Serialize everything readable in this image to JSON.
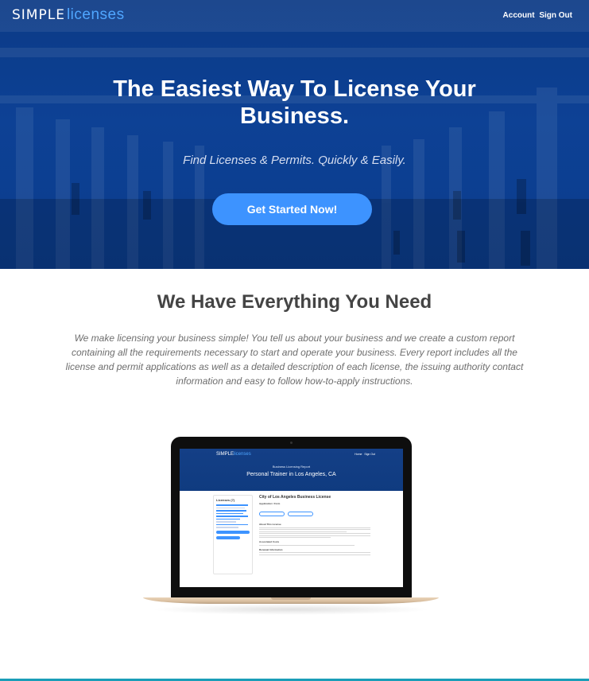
{
  "brand": {
    "part1": "SIMPLE",
    "part2": "licenses"
  },
  "nav": {
    "account": "Account",
    "signout": "Sign Out"
  },
  "hero": {
    "title": "The Easiest Way To License Your Business.",
    "subtitle": "Find Licenses & Permits. Quickly & Easily.",
    "cta": "Get Started Now!"
  },
  "section": {
    "title": "We Have Everything You Need",
    "text": "We make licensing your business simple! You tell us about your business and we create a custom report containing all the requirements necessary to start and operate your business. Every report includes all the license and permit applications as well as a detailed description of each license, the issuing authority contact information and easy to follow how-to-apply instructions."
  },
  "laptop_screen": {
    "brand1": "SIMPLE",
    "brand2": "licenses",
    "nav1": "Home",
    "nav2": "Sign Out",
    "caption": "Business Licensing Report",
    "title": "Personal Trainer in Los Angeles, CA",
    "sidebar_title": "Licenses (7)",
    "main_title": "City of Los Angeles Business License",
    "section1": "Application / Form",
    "section2": "About This License",
    "section3": "Associated Costs",
    "section4": "Renewal Information"
  },
  "colors": {
    "hero": "#0d4195",
    "accent": "#3d93ff",
    "brand_accent": "#4fa6ff",
    "footer_line": "#1a9eb8"
  }
}
